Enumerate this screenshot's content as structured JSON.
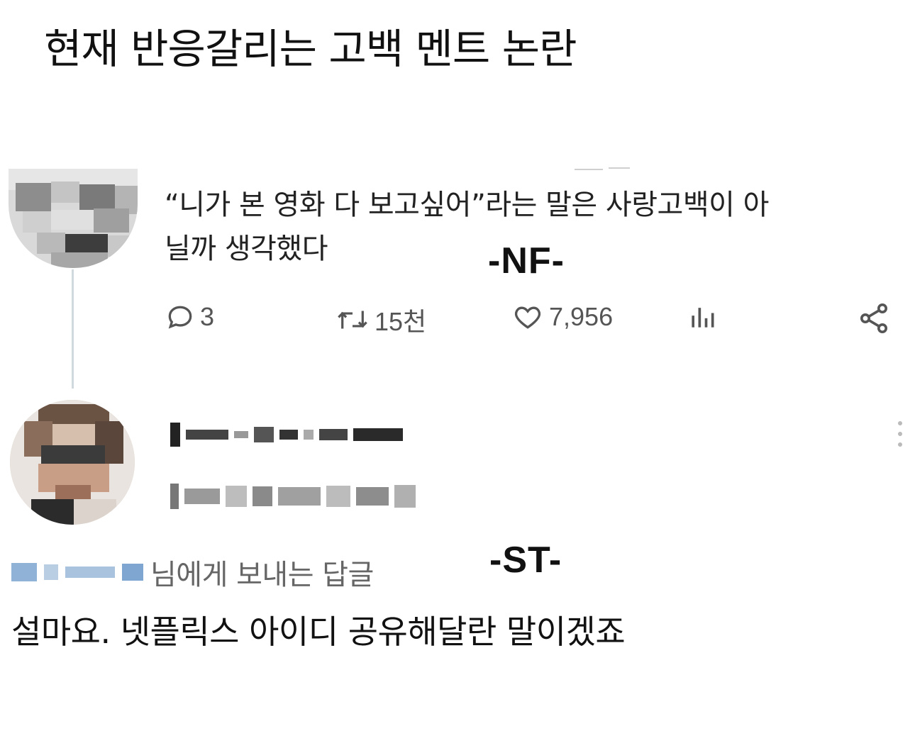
{
  "headline": "현재 반응갈리는 고백 멘트 논란",
  "tweet": {
    "text_line1": "“니가 본 영화 다 보고싶어”라는 말은 사랑고백이 아",
    "text_line2": "닐까 생각했다",
    "tag": "-NF-",
    "actions": {
      "reply_count": "3",
      "retweet_count": "15천",
      "like_count": "7,956"
    },
    "icons": [
      "reply-icon",
      "retweet-icon",
      "like-icon",
      "views-icon",
      "share-icon"
    ]
  },
  "reply": {
    "reply_to_suffix": "님에게 보내는 답글",
    "tag": "-ST-",
    "text": "설마요. 넷플릭스 아이디 공유해달란 말이겠죠",
    "more_icon": "more-vertical-icon"
  },
  "colors": {
    "text": "#111111",
    "muted": "#666666",
    "thread_line": "#cfd9de"
  }
}
